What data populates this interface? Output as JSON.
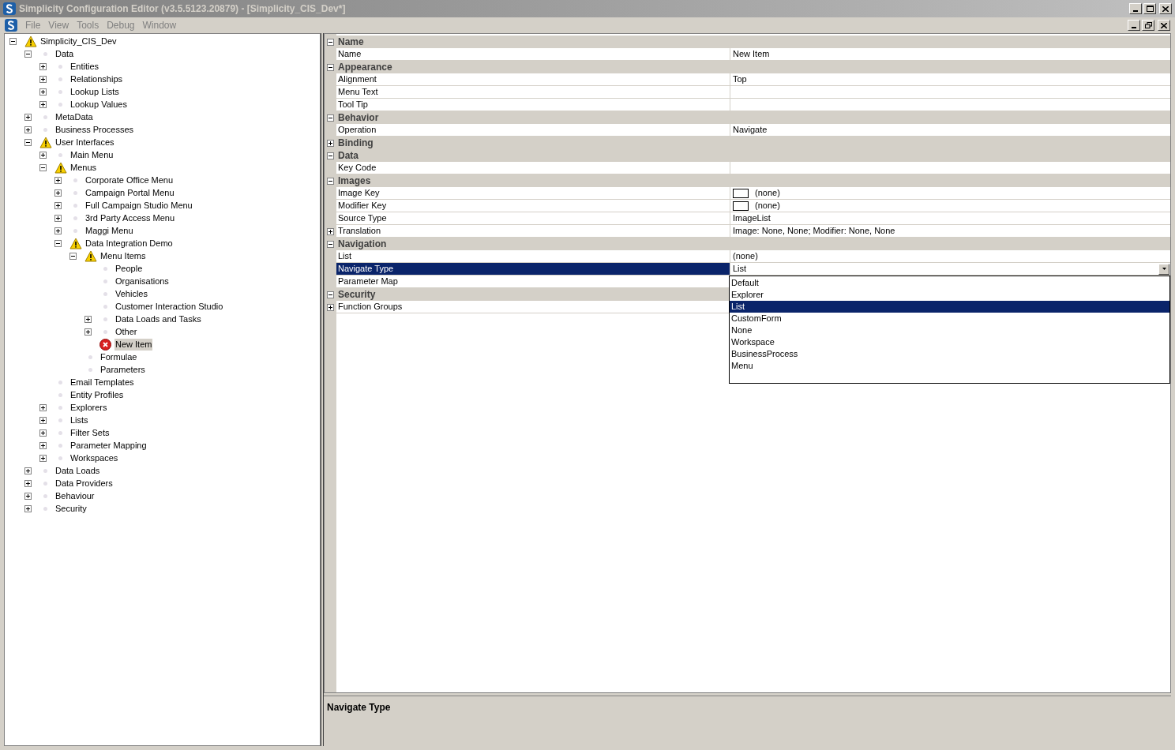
{
  "window": {
    "title": "Simplicity Configuration Editor (v3.5.5123.20879) - [Simplicity_CIS_Dev*]"
  },
  "menu": {
    "items": [
      "File",
      "View",
      "Tools",
      "Debug",
      "Window"
    ]
  },
  "tree": [
    {
      "label": "Simplicity_CIS_Dev",
      "kind": "warning",
      "expanded": true,
      "selected": false,
      "children": [
        {
          "label": "Data",
          "kind": "plain",
          "expanded": true,
          "selected": false,
          "children": [
            {
              "label": "Entities",
              "kind": "plain",
              "expanded": false,
              "selected": false
            },
            {
              "label": "Relationships",
              "kind": "plain",
              "expanded": false,
              "selected": false
            },
            {
              "label": "Lookup Lists",
              "kind": "plain",
              "expanded": false,
              "selected": false
            },
            {
              "label": "Lookup Values",
              "kind": "plain",
              "expanded": false,
              "selected": false
            }
          ]
        },
        {
          "label": "MetaData",
          "kind": "plain",
          "expanded": false,
          "selected": false
        },
        {
          "label": "Business Processes",
          "kind": "plain",
          "expanded": false,
          "selected": false
        },
        {
          "label": "User Interfaces",
          "kind": "warning",
          "expanded": true,
          "selected": false,
          "children": [
            {
              "label": "Main Menu",
              "kind": "plain",
              "expanded": false,
              "selected": false
            },
            {
              "label": "Menus",
              "kind": "warning",
              "expanded": true,
              "selected": false,
              "children": [
                {
                  "label": "Corporate Office Menu",
                  "kind": "plain",
                  "expanded": false,
                  "selected": false
                },
                {
                  "label": "Campaign Portal Menu",
                  "kind": "plain",
                  "expanded": false,
                  "selected": false
                },
                {
                  "label": "Full Campaign Studio Menu",
                  "kind": "plain",
                  "expanded": false,
                  "selected": false
                },
                {
                  "label": "3rd Party Access Menu",
                  "kind": "plain",
                  "expanded": false,
                  "selected": false
                },
                {
                  "label": "Maggi Menu",
                  "kind": "plain",
                  "expanded": false,
                  "selected": false
                },
                {
                  "label": "Data Integration Demo",
                  "kind": "warning",
                  "expanded": true,
                  "selected": false,
                  "children": [
                    {
                      "label": "Menu Items",
                      "kind": "warning",
                      "expanded": true,
                      "selected": false,
                      "children": [
                        {
                          "label": "People",
                          "kind": "plain",
                          "selected": false
                        },
                        {
                          "label": "Organisations",
                          "kind": "plain",
                          "selected": false
                        },
                        {
                          "label": "Vehicles",
                          "kind": "plain",
                          "selected": false
                        },
                        {
                          "label": "Customer Interaction Studio",
                          "kind": "plain",
                          "selected": false
                        },
                        {
                          "label": "Data Loads and Tasks",
                          "kind": "plain",
                          "expanded": false,
                          "selected": false
                        },
                        {
                          "label": "Other",
                          "kind": "plain",
                          "expanded": false,
                          "selected": false
                        },
                        {
                          "label": "New Item",
                          "kind": "error",
                          "selected": true
                        }
                      ]
                    },
                    {
                      "label": "Formulae",
                      "kind": "plain",
                      "selected": false
                    },
                    {
                      "label": "Parameters",
                      "kind": "plain",
                      "selected": false
                    }
                  ]
                }
              ]
            },
            {
              "label": "Email Templates",
              "kind": "plain",
              "selected": false
            },
            {
              "label": "Entity Profiles",
              "kind": "plain",
              "selected": false
            },
            {
              "label": "Explorers",
              "kind": "plain",
              "expanded": false,
              "selected": false
            },
            {
              "label": "Lists",
              "kind": "plain",
              "expanded": false,
              "selected": false
            },
            {
              "label": "Filter Sets",
              "kind": "plain",
              "expanded": false,
              "selected": false
            },
            {
              "label": "Parameter Mapping",
              "kind": "plain",
              "expanded": false,
              "selected": false
            },
            {
              "label": "Workspaces",
              "kind": "plain",
              "expanded": false,
              "selected": false
            }
          ]
        },
        {
          "label": "Data Loads",
          "kind": "plain",
          "expanded": false,
          "selected": false
        },
        {
          "label": "Data Providers",
          "kind": "plain",
          "expanded": false,
          "selected": false
        },
        {
          "label": "Behaviour",
          "kind": "plain",
          "expanded": false,
          "selected": false
        },
        {
          "label": "Security",
          "kind": "plain",
          "expanded": false,
          "selected": false
        }
      ]
    }
  ],
  "properties": [
    {
      "category": "Name",
      "expanded": true,
      "rows": [
        {
          "name": "Name",
          "value": "New Item",
          "kind": "text",
          "selected": false
        }
      ]
    },
    {
      "category": "Appearance",
      "expanded": true,
      "rows": [
        {
          "name": "Alignment",
          "value": "Top",
          "kind": "text",
          "selected": false
        },
        {
          "name": "Menu Text",
          "kind": "text",
          "selected": false
        },
        {
          "name": "Tool Tip",
          "kind": "text",
          "selected": false
        }
      ]
    },
    {
      "category": "Behavior",
      "expanded": true,
      "rows": [
        {
          "name": "Operation",
          "value": "Navigate",
          "kind": "text",
          "selected": false
        }
      ]
    },
    {
      "category": "Binding",
      "expanded": false
    },
    {
      "category": "Data",
      "expanded": true,
      "rows": [
        {
          "name": "Key Code",
          "kind": "text",
          "selected": false
        }
      ]
    },
    {
      "category": "Images",
      "expanded": true,
      "rows": [
        {
          "name": "Image Key",
          "value": "(none)",
          "kind": "image",
          "selected": false
        },
        {
          "name": "Modifier Key",
          "value": "(none)",
          "kind": "image",
          "selected": false
        },
        {
          "name": "Source Type",
          "value": "ImageList",
          "kind": "text",
          "selected": false
        },
        {
          "name": "Translation",
          "value": "Image: None, None; Modifier: None, None",
          "kind": "text",
          "expanded": false,
          "selected": false
        }
      ]
    },
    {
      "category": "Navigation",
      "expanded": true,
      "rows": [
        {
          "name": "List",
          "value": "(none)",
          "kind": "text",
          "selected": false
        },
        {
          "name": "Navigate Type",
          "value": "List",
          "kind": "dropdown",
          "selected": true
        },
        {
          "name": "Parameter Map",
          "kind": "text",
          "selected": false
        }
      ]
    },
    {
      "category": "Security",
      "expanded": true,
      "rows": [
        {
          "name": "Function Groups",
          "kind": "text",
          "expanded": false,
          "selected": false
        }
      ]
    }
  ],
  "dropdown": {
    "items": [
      {
        "label": "Default",
        "selected": false
      },
      {
        "label": "Explorer",
        "selected": false
      },
      {
        "label": "List",
        "selected": true
      },
      {
        "label": "CustomForm",
        "selected": false
      },
      {
        "label": "None",
        "selected": false
      },
      {
        "label": "Workspace",
        "selected": false
      },
      {
        "label": "BusinessProcess",
        "selected": false
      },
      {
        "label": "Menu",
        "selected": false
      }
    ]
  },
  "help": {
    "title": "Navigate Type"
  }
}
